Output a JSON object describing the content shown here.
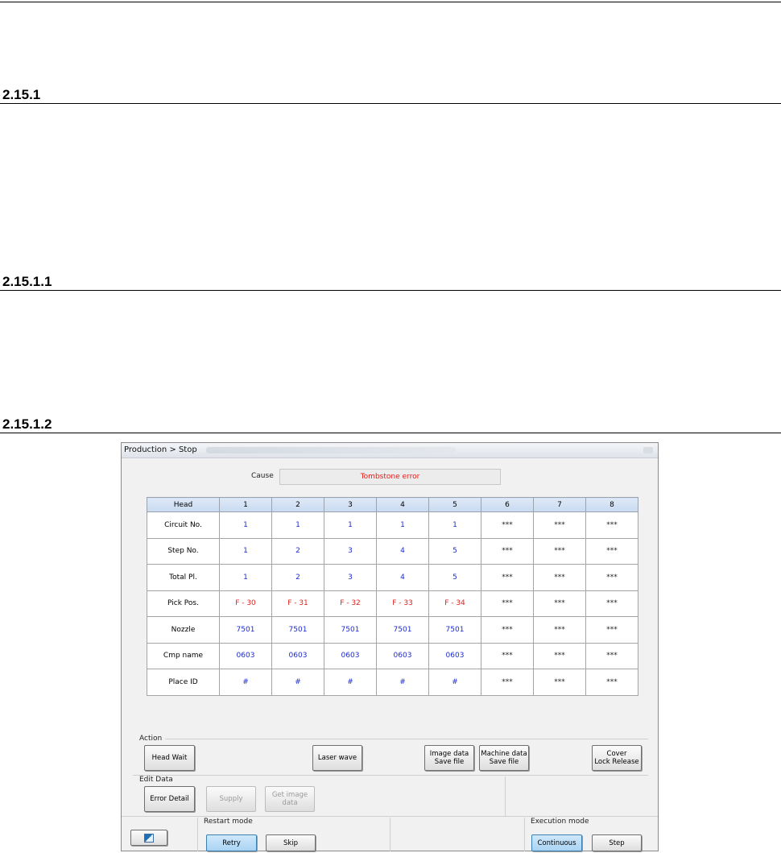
{
  "doc": {
    "h1": "2.15.1",
    "h2": "2.15.1.1",
    "h3": "2.15.1.2"
  },
  "window": {
    "title": "Production > Stop",
    "cause_label": "Cause",
    "cause_value": "Tombstone error"
  },
  "table": {
    "headers": [
      "Head",
      "1",
      "2",
      "3",
      "4",
      "5",
      "6",
      "7",
      "8"
    ],
    "rows": [
      {
        "label": "Circuit No.",
        "cells": [
          "1",
          "1",
          "1",
          "1",
          "1",
          "***",
          "***",
          "***"
        ]
      },
      {
        "label": "Step No.",
        "cells": [
          "1",
          "2",
          "3",
          "4",
          "5",
          "***",
          "***",
          "***"
        ]
      },
      {
        "label": "Total Pl.",
        "cells": [
          "1",
          "2",
          "3",
          "4",
          "5",
          "***",
          "***",
          "***"
        ]
      },
      {
        "label": "Pick Pos.",
        "cells": [
          "F - 30",
          "F - 31",
          "F - 32",
          "F - 33",
          "F - 34",
          "***",
          "***",
          "***"
        ]
      },
      {
        "label": "Nozzle",
        "cells": [
          "7501",
          "7501",
          "7501",
          "7501",
          "7501",
          "***",
          "***",
          "***"
        ]
      },
      {
        "label": "Cmp name",
        "cells": [
          "0603",
          "0603",
          "0603",
          "0603",
          "0603",
          "***",
          "***",
          "***"
        ]
      },
      {
        "label": "Place ID",
        "cells": [
          "#",
          "#",
          "#",
          "#",
          "#",
          "***",
          "***",
          "***"
        ]
      }
    ],
    "colors": {
      "value": "#1d2bd0",
      "pick": "#e0201b"
    }
  },
  "action": {
    "label": "Action",
    "head_wait": "Head Wait",
    "laser_wave": "Laser wave",
    "image_data_1": "Image data",
    "image_data_2": "Save file",
    "machine_data_1": "Machine data",
    "machine_data_2": "Save file",
    "cover_1": "Cover",
    "cover_2": "Lock Release"
  },
  "edit": {
    "label": "Edit Data",
    "error_detail": "Error Detail",
    "supply": "Supply",
    "get_image": "Get image data"
  },
  "restart": {
    "label": "Restart mode",
    "retry": "Retry",
    "skip": "Skip"
  },
  "execution": {
    "label": "Execution mode",
    "continuous": "Continuous",
    "step": "Step"
  }
}
